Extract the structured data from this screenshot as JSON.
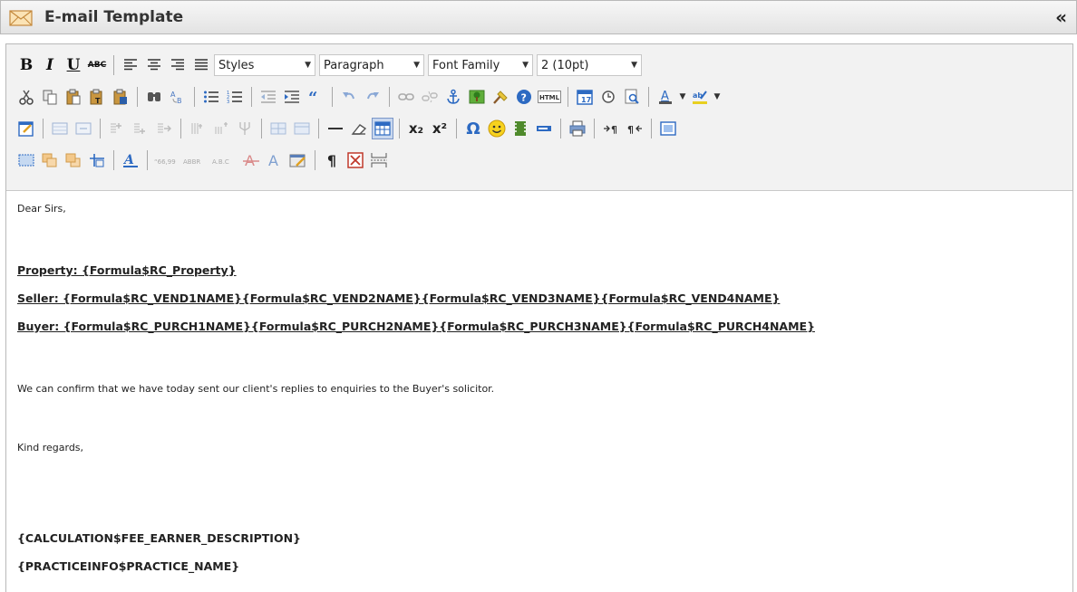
{
  "window": {
    "title": "E-mail Template",
    "title_icon": "envelope-icon",
    "collapse_label": "«"
  },
  "toolbar": {
    "bold": "B",
    "italic": "I",
    "underline": "U",
    "strikethrough": "ABC",
    "styles": "Styles",
    "paragraph": "Paragraph",
    "font_family": "Font Family",
    "font_size": "2 (10pt)",
    "subscript": "x₂",
    "superscript": "x²",
    "omega": "Ω",
    "pilcrow": "¶"
  },
  "content": {
    "greeting": "Dear Sirs,",
    "property": "Property: {Formula$RC_Property}",
    "seller": "Seller: {Formula$RC_VEND1NAME}{Formula$RC_VEND2NAME}{Formula$RC_VEND3NAME}{Formula$RC_VEND4NAME}",
    "buyer": "Buyer: {Formula$RC_PURCH1NAME}{Formula$RC_PURCH2NAME}{Formula$RC_PURCH3NAME}{Formula$RC_PURCH4NAME}",
    "body": "We can confirm that we have today sent our client's replies to enquiries to the Buyer's solicitor.",
    "closing": "Kind regards,",
    "fee_earner": "{CALCULATION$FEE_EARNER_DESCRIPTION}",
    "practice": "{PRACTICEINFO$PRACTICE_NAME}"
  }
}
